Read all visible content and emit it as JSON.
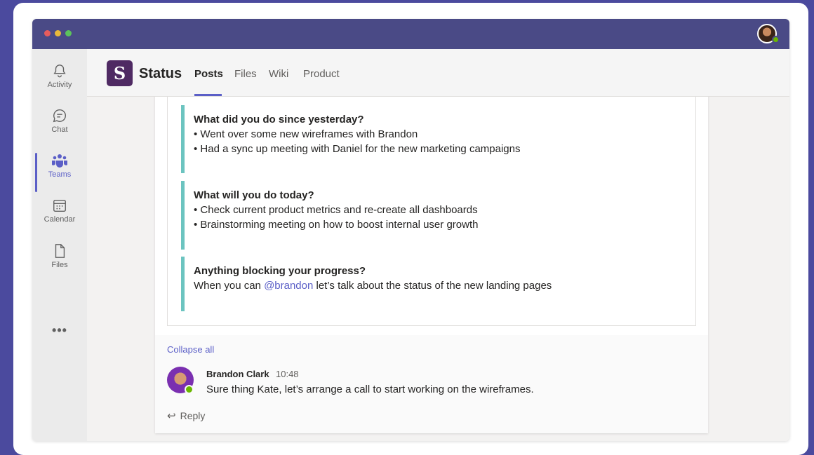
{
  "rail": {
    "items": [
      {
        "label": "Activity",
        "icon": "bell-icon"
      },
      {
        "label": "Chat",
        "icon": "chat-icon"
      },
      {
        "label": "Teams",
        "icon": "teams-icon"
      },
      {
        "label": "Calendar",
        "icon": "calendar-icon"
      },
      {
        "label": "Files",
        "icon": "file-icon"
      }
    ],
    "more": "•••"
  },
  "header": {
    "logo_glyph": "S",
    "title": "Status",
    "tabs": [
      {
        "label": "Posts",
        "active": true
      },
      {
        "label": "Files",
        "active": false
      },
      {
        "label": "Wiki",
        "active": false
      },
      {
        "label": "Product",
        "active": false
      }
    ]
  },
  "post": {
    "sections": [
      {
        "heading": "What did you do since yesterday?",
        "lines": [
          "• Went over some new wireframes with Brandon",
          "• Had a sync up meeting with Daniel for the new marketing campaigns"
        ]
      },
      {
        "heading": "What will you do today?",
        "lines": [
          "• Check current product metrics and re-create all dashboards",
          "• Brainstorming meeting on how to boost internal user growth"
        ]
      },
      {
        "heading": "Anything blocking your progress?",
        "line_prefix": "When you can ",
        "mention": "@brandon",
        "line_suffix": " let’s talk about the status of the new landing pages"
      }
    ]
  },
  "thread": {
    "collapse_label": "Collapse all",
    "reply": {
      "author": "Brandon Clark",
      "time": "10:48",
      "message": "Sure thing Kate, let’s arrange a call to start working on the wireframes."
    },
    "reply_label": "Reply"
  },
  "colors": {
    "accent": "#5b5fc7",
    "titlebar": "#4a4a86",
    "section_bar": "#6cc4c0",
    "brand": "#4f2a63"
  }
}
